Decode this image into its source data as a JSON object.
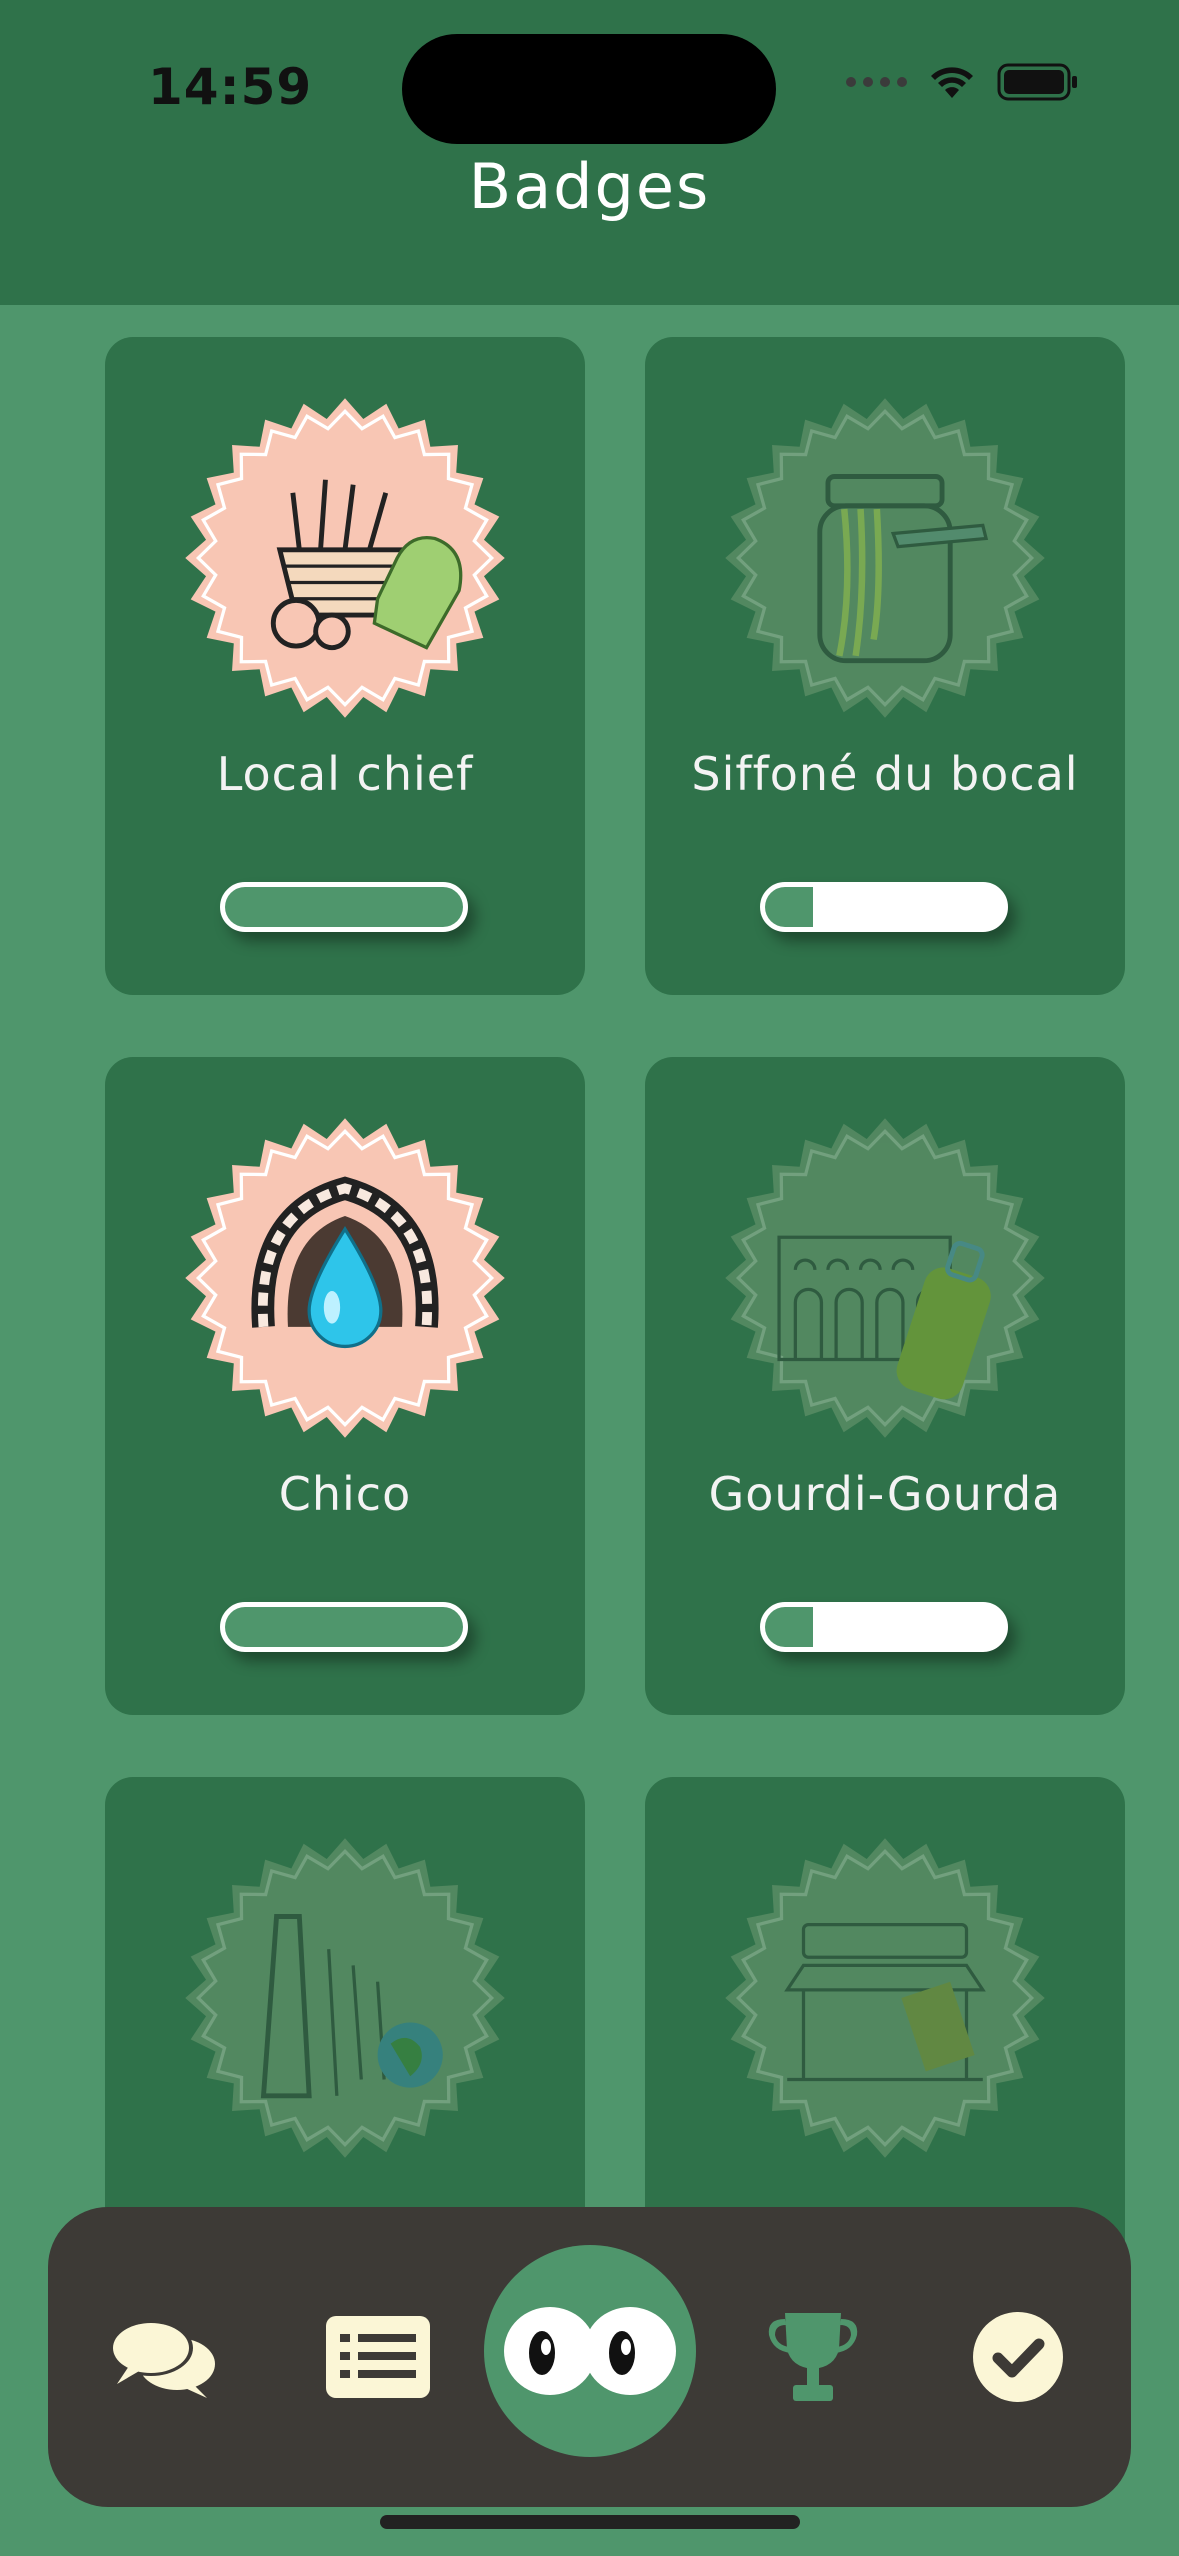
{
  "status_bar": {
    "time": "14:59"
  },
  "header": {
    "title": "Badges"
  },
  "badges": [
    {
      "name": "Local chief",
      "progress": 1.0,
      "unlocked": true
    },
    {
      "name": "Siffoné du bocal",
      "progress": 0.2,
      "unlocked": false
    },
    {
      "name": "Chico",
      "progress": 1.0,
      "unlocked": true
    },
    {
      "name": "Gourdi-Gourda",
      "progress": 0.2,
      "unlocked": false
    },
    {
      "name": "",
      "progress": 0,
      "unlocked": false
    },
    {
      "name": "",
      "progress": 0,
      "unlocked": false
    }
  ],
  "nav": {
    "items": [
      {
        "icon": "chat-bubbles-icon"
      },
      {
        "icon": "list-icon"
      },
      {
        "icon": "eyes-icon",
        "active": true
      },
      {
        "icon": "trophy-icon"
      },
      {
        "icon": "check-circle-icon"
      }
    ]
  },
  "colors": {
    "background": "#4f966c",
    "card": "#2f724a",
    "badge_unlocked": "#f8c6b4",
    "badge_locked": "#6f9a73",
    "nav_bg": "#3d3a36",
    "cream": "#fbf6d6"
  }
}
